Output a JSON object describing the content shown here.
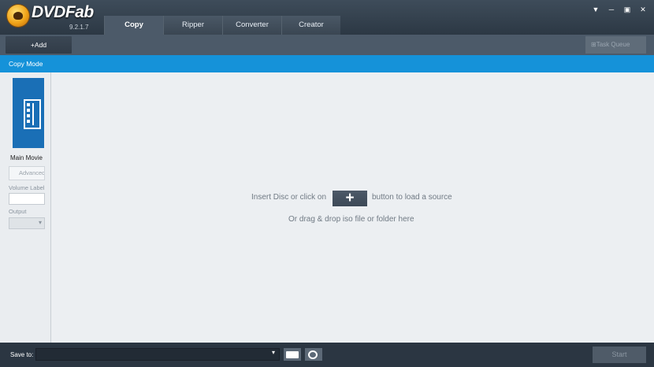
{
  "app": {
    "name": "DVDFab",
    "version": "9.2.1.7"
  },
  "tabs": [
    {
      "label": "Copy",
      "active": true
    },
    {
      "label": "Ripper",
      "active": false
    },
    {
      "label": "Converter",
      "active": false
    },
    {
      "label": "Creator",
      "active": false
    }
  ],
  "window_controls": {
    "menu": "▼",
    "minimize": "─",
    "restore": "▣",
    "close": "✕"
  },
  "toolbar": {
    "add_label": "+Add",
    "queue_label": "Task Queue"
  },
  "mode_bar": {
    "label": "Copy Mode"
  },
  "sidebar": {
    "mode_label": "Main Movie",
    "advanced_label": "Advanced",
    "volume_label": "Volume Label",
    "output_label": "Output"
  },
  "main": {
    "insert_text": "Insert Disc or click on",
    "plus_label": "+",
    "load_text": "button to load a source",
    "drag_text": "Or drag & drop iso file or folder here"
  },
  "bottom": {
    "save_to_label": "Save to:",
    "dropdown_arrow": "▾",
    "start_label": "Start"
  },
  "colors": {
    "accent": "#1592d9",
    "tile": "#1a6fb6",
    "main_bg": "#eceff2",
    "chrome": "#2f3c4a"
  }
}
